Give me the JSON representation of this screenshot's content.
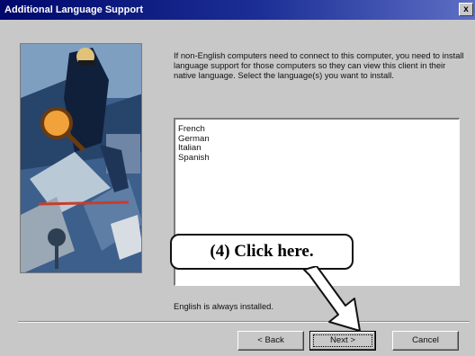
{
  "window": {
    "title": "Additional Language Support",
    "close_glyph": "x"
  },
  "artwork": {
    "icon": "setup-artwork-illustration"
  },
  "description": "If non-English computers need to connect to this computer, you need to install language support for those computers so they can view this client in their native language. Select the language(s) you want to install.",
  "languages": [
    "French",
    "German",
    "Italian",
    "Spanish"
  ],
  "footnote": "English is always installed.",
  "buttons": {
    "back": "< Back",
    "next": "Next >",
    "cancel": "Cancel"
  },
  "callout": {
    "text": "(4)  Click here.",
    "arrow_icon": "pointer-arrow-icon"
  },
  "colors": {
    "titlebar_start": "#00086b",
    "titlebar_end": "#5d6fc4",
    "dialog_bg": "#c8c8c8"
  }
}
